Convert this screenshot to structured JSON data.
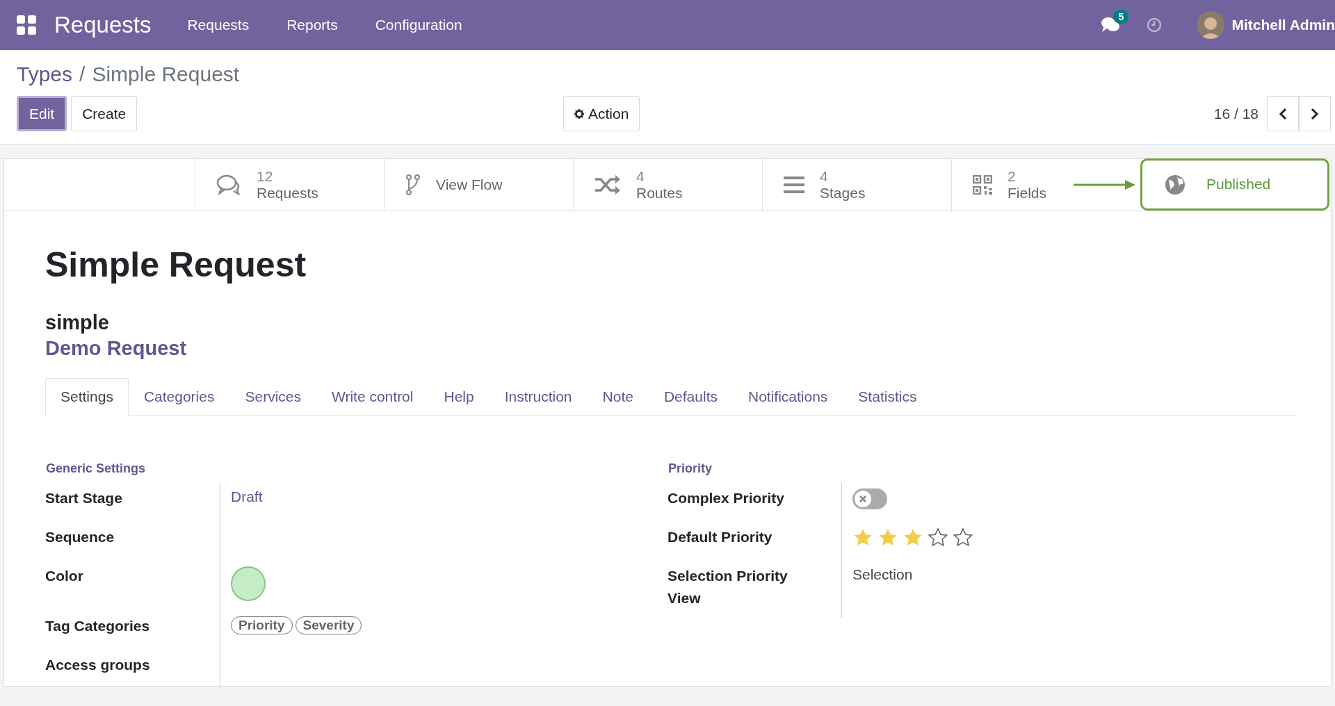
{
  "navbar": {
    "app_name": "Requests",
    "menu": [
      "Requests",
      "Reports",
      "Configuration"
    ],
    "chat_count": "5",
    "user": "Mitchell Admin"
  },
  "breadcrumb": [
    {
      "label": "Types",
      "kind": "link"
    },
    {
      "label": "Simple Request",
      "kind": "current"
    }
  ],
  "breadcrumb_separator": "/",
  "toolbar": {
    "buttons": [
      {
        "label": "Edit",
        "primary": true
      },
      {
        "label": "Create",
        "primary": false
      }
    ],
    "action": "Action",
    "pager": "16 / 18"
  },
  "stat_buttons": [
    {
      "kind": "requests",
      "value": "12",
      "label": "Requests",
      "highlighted": false
    },
    {
      "kind": "flow",
      "label": "View Flow",
      "highlighted": false
    },
    {
      "kind": "routes",
      "value": "4",
      "label": "Routes",
      "highlighted": false
    },
    {
      "kind": "stages",
      "value": "4",
      "label": "Stages",
      "highlighted": false
    },
    {
      "kind": "fields",
      "value": "2",
      "label": "Fields",
      "highlighted": false
    },
    {
      "kind": "published",
      "label": "Published",
      "highlighted": true
    }
  ],
  "record": {
    "title": "Simple Request",
    "code": "simple",
    "subtitle": "Demo Request"
  },
  "tabs": [
    {
      "label": "Settings",
      "selected": true
    },
    {
      "label": "Categories",
      "selected": false
    },
    {
      "label": "Services",
      "selected": false
    },
    {
      "label": "Write control",
      "selected": false
    },
    {
      "label": "Help",
      "selected": false
    },
    {
      "label": "Instruction",
      "selected": false
    },
    {
      "label": "Note",
      "selected": false
    },
    {
      "label": "Defaults",
      "selected": false
    },
    {
      "label": "Notifications",
      "selected": false
    },
    {
      "label": "Statistics",
      "selected": false
    }
  ],
  "groups": [
    {
      "title": "Generic Settings",
      "fields": [
        {
          "kind": "link",
          "label": "Start Stage",
          "value": "Draft"
        },
        {
          "kind": "empty",
          "label": "Sequence"
        },
        {
          "kind": "color",
          "label": "Color",
          "color": "#c4ecc6"
        },
        {
          "kind": "tags",
          "label": "Tag Categories",
          "tags": [
            "Priority",
            "Severity"
          ]
        },
        {
          "kind": "empty",
          "label": "Access groups"
        }
      ]
    },
    {
      "title": "Priority",
      "fields": [
        {
          "kind": "toggle",
          "label": "Complex Priority",
          "on": false
        },
        {
          "kind": "stars",
          "label": "Default Priority",
          "stars": 3
        },
        {
          "kind": "text",
          "label": "Selection Priority View",
          "value": "Selection"
        }
      ]
    }
  ]
}
